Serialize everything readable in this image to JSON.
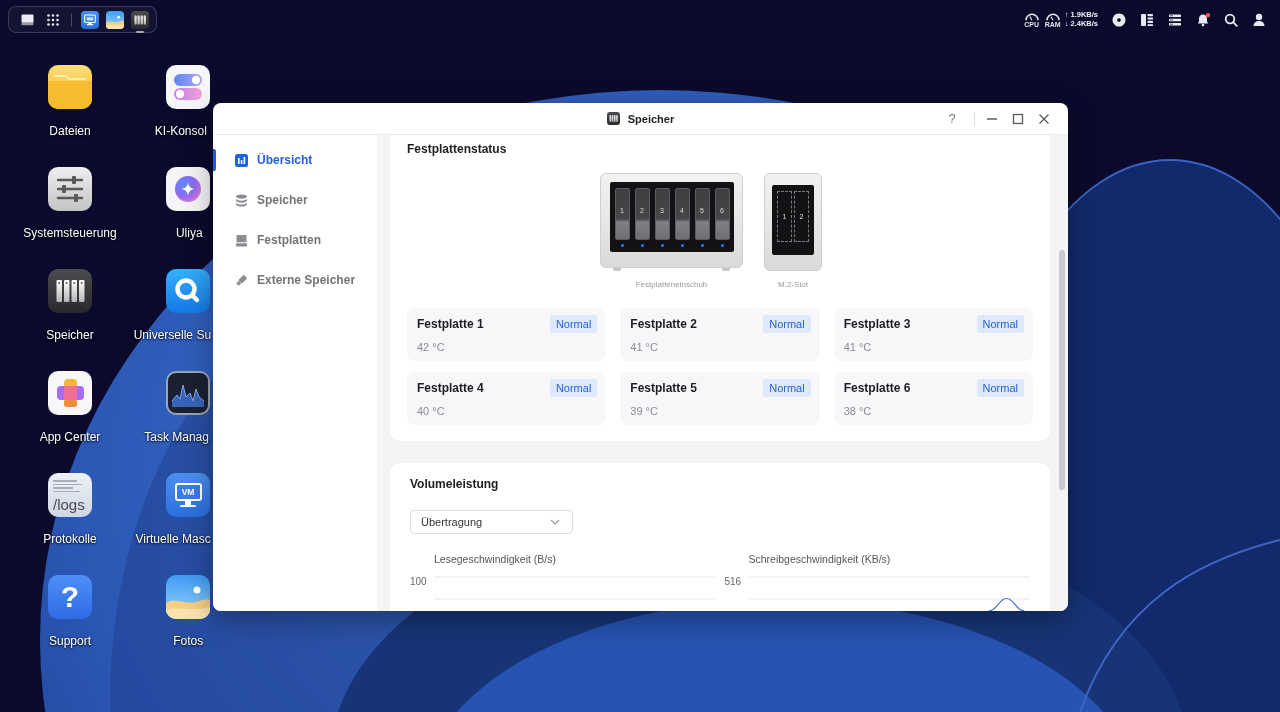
{
  "taskbar": {
    "launchers": [
      {
        "kind": "desktop"
      },
      {
        "kind": "apps"
      }
    ],
    "apps": [
      {
        "kind": "vm",
        "active": false
      },
      {
        "kind": "photos",
        "active": false
      },
      {
        "kind": "storage",
        "active": true
      }
    ]
  },
  "status_area": {
    "gauges": [
      {
        "label": "CPU"
      },
      {
        "label": "RAM"
      }
    ],
    "upload": "↑ 1.9KB/s",
    "download": "↓ 2.4KB/s",
    "tray": [
      {
        "kind": "disc",
        "alert": false
      },
      {
        "kind": "widgets",
        "alert": false
      },
      {
        "kind": "tasks",
        "alert": false
      },
      {
        "kind": "notifications",
        "alert": true
      },
      {
        "kind": "search",
        "alert": false
      },
      {
        "kind": "account",
        "alert": false
      }
    ]
  },
  "desktop": {
    "apps": [
      {
        "kind": "files",
        "label": "Dateien"
      },
      {
        "kind": "ai-console",
        "label": "KI-Konsol"
      },
      {
        "kind": "settings",
        "label": "Systemsteuerung"
      },
      {
        "kind": "assistant",
        "label": "Uliya"
      },
      {
        "kind": "storage",
        "label": "Speicher"
      },
      {
        "kind": "search",
        "label": "Universelle Su"
      },
      {
        "kind": "app-center",
        "label": "App Center"
      },
      {
        "kind": "task-manager",
        "label": "Task Manag"
      },
      {
        "kind": "logs",
        "label": "Protokolle",
        "icon_text": "/logs"
      },
      {
        "kind": "vm",
        "label": "Virtuelle Masc",
        "icon_text": "VM"
      },
      {
        "kind": "support",
        "label": "Support",
        "icon_text": "?"
      },
      {
        "kind": "photos",
        "label": "Fotos"
      }
    ]
  },
  "window": {
    "title": "Speicher",
    "help": "?",
    "sidebar": [
      {
        "kind": "overview",
        "label": "Übersicht",
        "selected": true
      },
      {
        "kind": "storage",
        "label": "Speicher",
        "selected": false
      },
      {
        "kind": "disks",
        "label": "Festplatten",
        "selected": false
      },
      {
        "kind": "external",
        "label": "Externe Speicher",
        "selected": false
      }
    ],
    "disk_status": {
      "title": "Festplattenstatus",
      "enclosures": [
        {
          "kind": "bay",
          "label": "Festplatteneinschub",
          "slots": [
            "1",
            "2",
            "3",
            "4",
            "5",
            "6"
          ]
        },
        {
          "kind": "m2",
          "label": "M.2-Slot",
          "slots": [
            "1",
            "2"
          ]
        }
      ],
      "disks": [
        {
          "name": "Festplatte 1",
          "status": "Normal",
          "temperature": "42 °C"
        },
        {
          "name": "Festplatte 2",
          "status": "Normal",
          "temperature": "41 °C"
        },
        {
          "name": "Festplatte 3",
          "status": "Normal",
          "temperature": "41 °C"
        },
        {
          "name": "Festplatte 4",
          "status": "Normal",
          "temperature": "40 °C"
        },
        {
          "name": "Festplatte 5",
          "status": "Normal",
          "temperature": "39 °C"
        },
        {
          "name": "Festplatte 6",
          "status": "Normal",
          "temperature": "38 °C"
        }
      ]
    },
    "volume_performance": {
      "title": "Volumeleistung",
      "dropdown": {
        "value": "Übertragung"
      },
      "charts": [
        {
          "title": "Lesegeschwindigkeit (B/s)",
          "tick": "100",
          "kind": "idle"
        },
        {
          "title": "Schreibgeschwindigkeit (KB/s)",
          "tick": "516",
          "kind": "spike"
        }
      ]
    }
  }
}
